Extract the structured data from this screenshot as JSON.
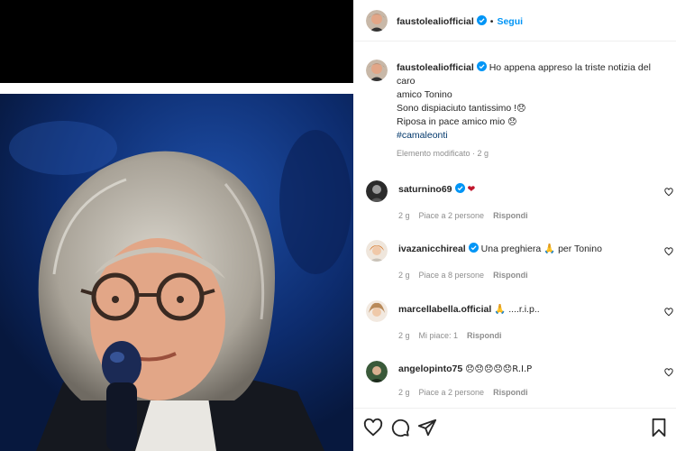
{
  "post": {
    "username": "faustolealiofficial",
    "dot": "•",
    "follow_label": "Segui",
    "caption_username": "faustolealiofficial",
    "caption_line1": "Ho appena appreso la triste notizia del caro",
    "caption_line2": "amico Tonino",
    "caption_line3": "Sono dispiaciuto tantissimo !",
    "caption_line3_emoji": "😞",
    "caption_line4": "Riposa in pace amico mio",
    "caption_line4_emoji": "😞",
    "hashtag": "#camaleonti",
    "edited_label": "Elemento modificato · 2 g"
  },
  "comments": [
    {
      "username": "saturnino69",
      "text": "❤",
      "time": "2 g",
      "likes": "Piace a 2 persone",
      "reply": "Rispondi"
    },
    {
      "username": "ivazanicchireal",
      "text": "Una preghiera 🙏 per Tonino",
      "time": "2 g",
      "likes": "Piace a 8 persone",
      "reply": "Rispondi"
    },
    {
      "username": "marcellabella.official",
      "text": "🙏 ....r.i.p..",
      "time": "2 g",
      "likes": "Mi piace: 1",
      "reply": "Rispondi"
    },
    {
      "username": "angelopinto75",
      "text": "😞😞😞😞😞R.I.P",
      "time": "2 g",
      "likes": "Piace a 2 persone",
      "reply": "Rispondi"
    }
  ],
  "colors": {
    "accent": "#0095f6",
    "verified": "#0095f6",
    "heart": "#c0142b"
  },
  "icons": [
    "heart-icon",
    "comment-icon",
    "share-icon",
    "bookmark-icon",
    "verified-icon"
  ]
}
